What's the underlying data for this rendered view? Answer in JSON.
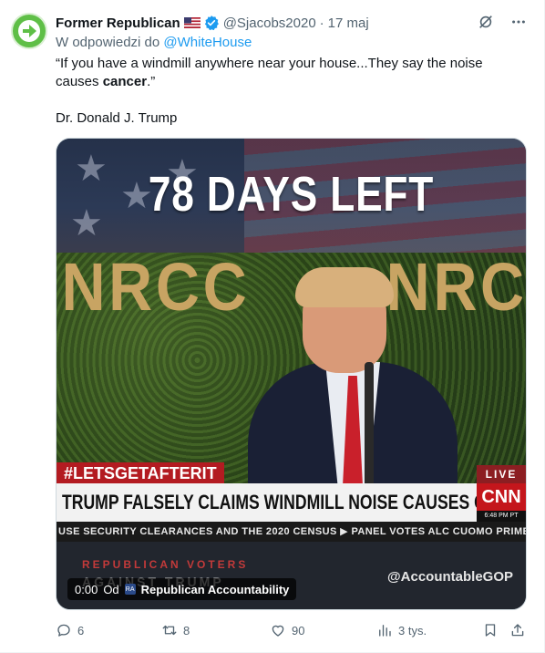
{
  "tweet": {
    "author_name": "Former Republican",
    "handle": "@Sjacobs2020",
    "separator": "·",
    "timestamp": "17 maj",
    "reply_prefix": "W odpowiedzi do",
    "reply_target": "@WhiteHouse",
    "text_line1_start": "“If you have a windmill anywhere near your house...They say the noise causes ",
    "text_line1_bold": "cancer",
    "text_line1_end": ".”",
    "signature": "Dr. Donald J. Trump"
  },
  "media": {
    "headline_top": "78 DAYS LEFT",
    "backdrop_left": "NRCC",
    "backdrop_right": "NRC",
    "hashtag": "#LETSGETAFTERIT",
    "live_label": "LIVE",
    "chyron": "TRUMP FALSELY CLAIMS WINDMILL NOISE CAUSES CANCER",
    "network": "CNN",
    "network_time": "6:48 PM PT",
    "ticker": "USE SECURITY CLEARANCES AND THE 2020 CENSUS   ▶  PANEL VOTES ALC  CUOMO PRIME TIME",
    "overlay_line1": "REPUBLICAN VOTERS",
    "overlay_line2": "AGAINST TRUMP",
    "watermark": "@AccountableGOP",
    "video_time": "0:00",
    "video_from": "Od",
    "video_source_badge": "RA",
    "video_source": "Republican Accountability"
  },
  "actions": {
    "replies": "6",
    "retweets": "8",
    "likes": "90",
    "views": "3 tys."
  },
  "colors": {
    "accent": "#1d9bf0",
    "muted": "#536471",
    "text": "#0f1419",
    "avatar": "#5fbf47",
    "cnn_red": "#c4161c"
  }
}
